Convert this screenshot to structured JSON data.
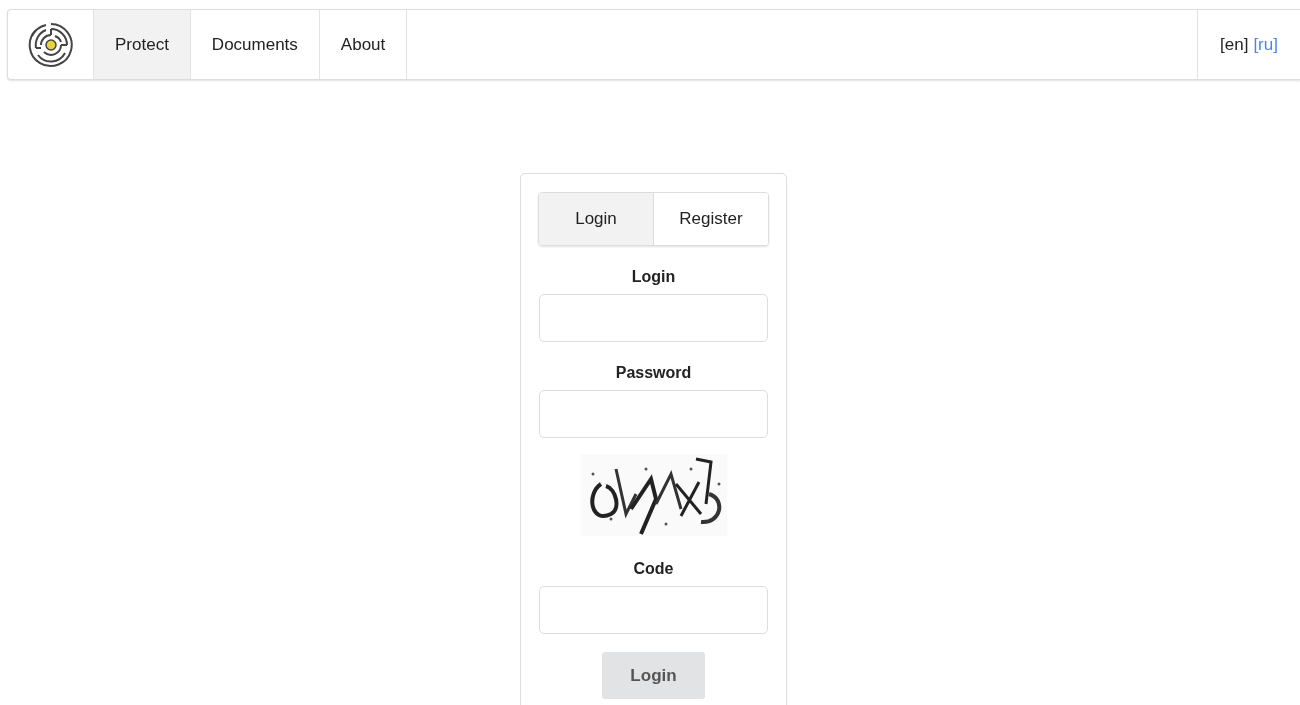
{
  "nav": {
    "items": [
      {
        "label": "Protect",
        "selected": true
      },
      {
        "label": "Documents",
        "selected": false
      },
      {
        "label": "About",
        "selected": false
      }
    ],
    "languages": [
      {
        "label": "[en]",
        "selected": true
      },
      {
        "label": "[ru]",
        "selected": false
      }
    ]
  },
  "form": {
    "tabs": [
      {
        "label": "Login",
        "selected": true
      },
      {
        "label": "Register",
        "selected": false
      }
    ],
    "fields": [
      {
        "kind": "input",
        "label": "Login"
      },
      {
        "kind": "input",
        "label": "Password"
      },
      {
        "kind": "captcha"
      },
      {
        "kind": "input",
        "label": "Code"
      }
    ],
    "submit": {
      "label": "Login",
      "disabled": true
    }
  }
}
